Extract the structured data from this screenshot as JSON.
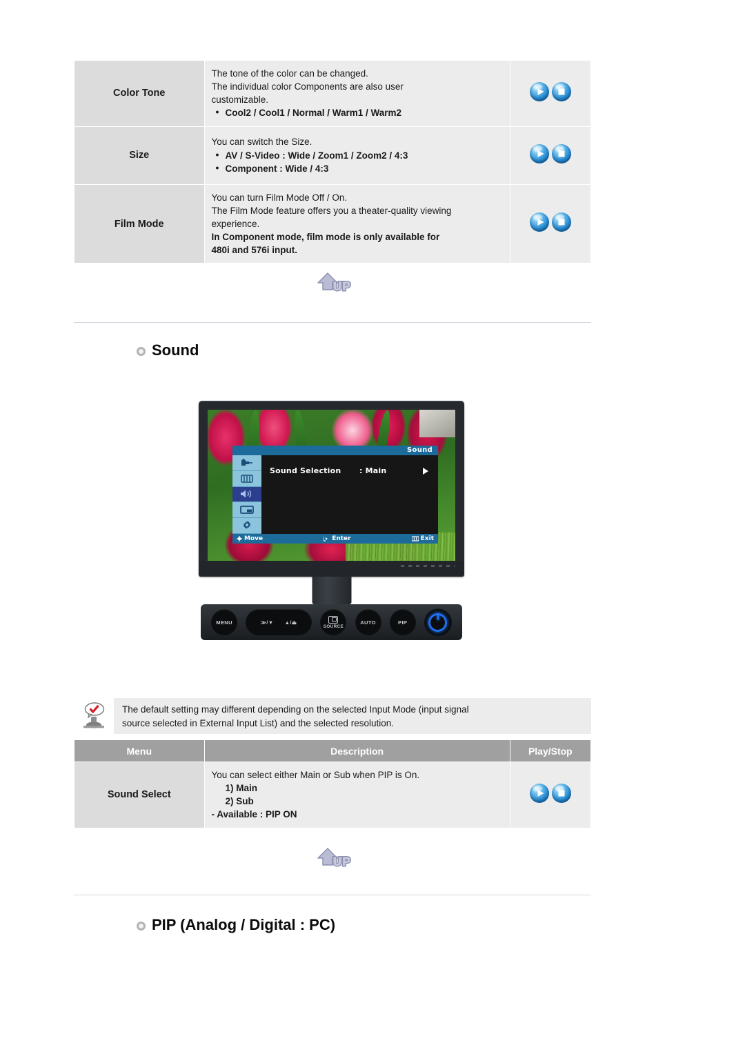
{
  "picture_table": {
    "rows": [
      {
        "menu": "Color Tone",
        "lines": [
          {
            "text": "The tone of the color can be changed.",
            "style": "plain"
          },
          {
            "text": "The individual color Components are also user",
            "style": "plain"
          },
          {
            "text": "customizable.",
            "style": "plain"
          },
          {
            "text": "Cool2 / Cool1 / Normal / Warm1 / Warm2",
            "style": "bullet"
          }
        ],
        "play": "play-stop-icons"
      },
      {
        "menu": "Size",
        "lines": [
          {
            "text": "You can switch the Size.",
            "style": "plain"
          },
          {
            "text": "AV / S-Video : Wide / Zoom1 / Zoom2 / 4:3",
            "style": "bullet"
          },
          {
            "text": "Component : Wide / 4:3",
            "style": "bullet"
          }
        ],
        "play": "play-stop-icons"
      },
      {
        "menu": "Film Mode",
        "lines": [
          {
            "text": "You can turn Film Mode Off / On.",
            "style": "plain"
          },
          {
            "text": "The Film Mode feature offers you a theater-quality viewing",
            "style": "plain"
          },
          {
            "text": "experience.",
            "style": "plain"
          },
          {
            "text": "In Component mode, film mode is only available for",
            "style": "bold"
          },
          {
            "text": "480i and 576i input.",
            "style": "bold"
          }
        ],
        "play": "play-stop-icons"
      }
    ]
  },
  "up_button_top": {
    "label": "UP"
  },
  "up_button_bottom": {
    "label": "UP"
  },
  "sound_section": {
    "heading": "Sound",
    "bullet_icon": "gear-bullet-icon"
  },
  "monitor": {
    "osd": {
      "title": "Sound",
      "row": {
        "label": "Sound Selection",
        "value": ": Main",
        "arrow_icon": "right-arrow-icon"
      },
      "sidebar_icons": [
        "input-source-icon",
        "picture-bars-icon",
        "speaker-icon",
        "pip-window-icon",
        "setup-gear-icon"
      ],
      "active_sidebar_index": 2,
      "footer": {
        "move": "Move",
        "enter": "Enter",
        "exit": "Exit"
      }
    },
    "buttons": [
      {
        "name": "menu-button",
        "label": "MENU"
      },
      {
        "name": "adjust-button",
        "label_left": "≫/▼",
        "label_right": "▲/⏏"
      },
      {
        "name": "source-button",
        "label": "SOURCE"
      },
      {
        "name": "auto-button",
        "label": "AUTO"
      },
      {
        "name": "pip-button",
        "label": "PIP"
      },
      {
        "name": "power-button",
        "label": ""
      }
    ]
  },
  "note": {
    "icon": "note-figure-icon",
    "line1": "The default setting may different depending on the selected Input Mode (input signal",
    "line2": "source selected in External Input List) and the selected resolution."
  },
  "sound_table": {
    "headers": {
      "menu": "Menu",
      "description": "Description",
      "playstop": "Play/Stop"
    },
    "rows": [
      {
        "menu": "Sound Select",
        "lines": [
          {
            "text": "You can select either Main or Sub when PIP is On.",
            "style": "plain"
          },
          {
            "text": "1) Main",
            "style": "indent"
          },
          {
            "text": "2) Sub",
            "style": "indent"
          },
          {
            "text": "- Available : PIP ON",
            "style": "bold"
          }
        ],
        "play": "play-stop-icons"
      }
    ]
  },
  "pip_section": {
    "heading": "PIP (Analog / Digital : PC)",
    "bullet_icon": "gear-bullet-icon"
  },
  "colors": {
    "header_gray": "#a0a0a0",
    "menu_cell_gray": "#dcdcdc",
    "desc_cell_gray": "#ececec",
    "table_border": "#a8a8a8",
    "rule": "#d6d6de",
    "osd_blue": "#1d6b9b",
    "power_blue": "#1d6ff0"
  }
}
